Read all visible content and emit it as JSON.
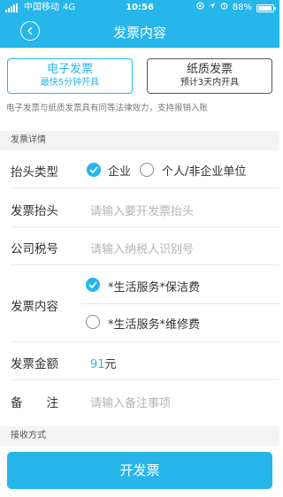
{
  "status": {
    "carrier": "中国移动",
    "network": "4G",
    "time": "10:56",
    "battery": "88%",
    "battery_level": 0.88
  },
  "header": {
    "title": "发票内容"
  },
  "invoice_type": {
    "electronic": {
      "title": "电子发票",
      "subtitle": "最快5分钟开具"
    },
    "paper": {
      "title": "纸质发票",
      "subtitle": "预计3天内开具"
    }
  },
  "note": "电子发票与纸质发票具有同等法律效力，支持报销入账",
  "details": {
    "section_label": "发票详情",
    "header_type": {
      "label": "抬头类型",
      "options": [
        "企业",
        "个人/非企业单位"
      ]
    },
    "invoice_title": {
      "label": "发票抬头",
      "placeholder": "请输入要开发票抬头"
    },
    "tax_id": {
      "label": "公司税号",
      "placeholder": "请输入纳税人识别号"
    },
    "content": {
      "label": "发票内容",
      "options": [
        "*生活服务*保洁费",
        "*生活服务*维修费"
      ]
    },
    "amount": {
      "label": "发票金额",
      "value": "91",
      "unit": "元"
    },
    "remark": {
      "label": "备　　注",
      "placeholder": "请输入备注事项"
    }
  },
  "receive": {
    "section_label": "接收方式"
  },
  "submit_label": "开发票",
  "colors": {
    "accent": "#27b6ea",
    "text": "#333333",
    "placeholder": "#b5b5b5"
  }
}
